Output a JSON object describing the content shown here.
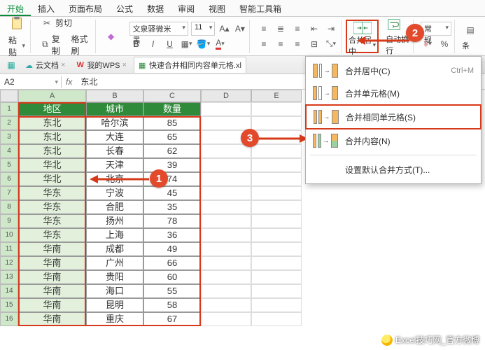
{
  "tabs": [
    "开始",
    "插入",
    "页面布局",
    "公式",
    "数据",
    "审阅",
    "视图",
    "智能工具箱"
  ],
  "active_tab": 0,
  "ribbon": {
    "paste": "粘贴",
    "cut": "剪切",
    "copy": "复制",
    "fmtpaint": "格式刷",
    "font_name": "文泉驿微米黑",
    "font_size": "11",
    "merge_label": "合并居中",
    "wrap_label": "自动换行",
    "numfmt": "常规",
    "cond": "条"
  },
  "doctabs": {
    "cloud": "云文档",
    "mywps": "我的WPS",
    "file": "快速合并相同内容单元格.xl"
  },
  "fbar": {
    "name_box": "A2",
    "fx": "fx",
    "value": "东北"
  },
  "cols": [
    "A",
    "B",
    "C",
    "D",
    "E"
  ],
  "headers": {
    "a": "地区",
    "b": "城市",
    "c": "数量"
  },
  "data": [
    {
      "a": "东北",
      "b": "哈尔滨",
      "c": "85"
    },
    {
      "a": "东北",
      "b": "大连",
      "c": "65"
    },
    {
      "a": "东北",
      "b": "长春",
      "c": "62"
    },
    {
      "a": "华北",
      "b": "天津",
      "c": "39"
    },
    {
      "a": "华北",
      "b": "北京",
      "c": "74"
    },
    {
      "a": "华东",
      "b": "宁波",
      "c": "45"
    },
    {
      "a": "华东",
      "b": "合肥",
      "c": "35"
    },
    {
      "a": "华东",
      "b": "扬州",
      "c": "78"
    },
    {
      "a": "华东",
      "b": "上海",
      "c": "36"
    },
    {
      "a": "华南",
      "b": "成都",
      "c": "49"
    },
    {
      "a": "华南",
      "b": "广州",
      "c": "66"
    },
    {
      "a": "华南",
      "b": "贵阳",
      "c": "60"
    },
    {
      "a": "华南",
      "b": "海口",
      "c": "55"
    },
    {
      "a": "华南",
      "b": "昆明",
      "c": "58"
    },
    {
      "a": "华南",
      "b": "重庆",
      "c": "67"
    }
  ],
  "row_nums": [
    "1",
    "2",
    "3",
    "4",
    "5",
    "6",
    "7",
    "8",
    "9",
    "10",
    "11",
    "12",
    "13",
    "14",
    "15",
    "16"
  ],
  "dropdown": {
    "items": [
      {
        "label": "合并居中(C)",
        "shortcut": "Ctrl+M"
      },
      {
        "label": "合并单元格(M)"
      },
      {
        "label": "合并相同单元格(S)"
      },
      {
        "label": "合并内容(N)"
      }
    ],
    "default": "设置默认合并方式(T)..."
  },
  "badges": {
    "1": "1",
    "2": "2",
    "3": "3"
  },
  "watermark": "Excel技巧网_官方微博"
}
